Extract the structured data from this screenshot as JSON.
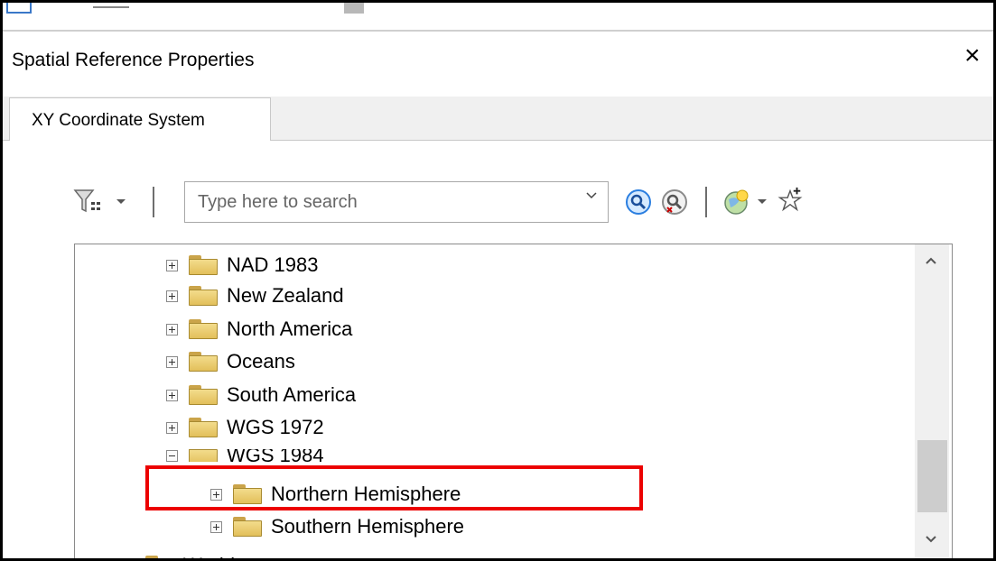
{
  "dialog": {
    "title": "Spatial Reference Properties",
    "close_glyph": "×"
  },
  "tabs": [
    {
      "label": "XY Coordinate System",
      "active": true
    }
  ],
  "toolbar": {
    "search_placeholder": "Type here to search"
  },
  "tree": {
    "items": [
      {
        "label": "NAD 1983",
        "expanded": false
      },
      {
        "label": "New Zealand",
        "expanded": false
      },
      {
        "label": "North America",
        "expanded": false
      },
      {
        "label": "Oceans",
        "expanded": false
      },
      {
        "label": "South America",
        "expanded": false
      },
      {
        "label": "WGS 1972",
        "expanded": false
      },
      {
        "label": "WGS 1984",
        "expanded": true
      },
      {
        "label": "Northern Hemisphere",
        "expanded": false,
        "highlighted": true
      },
      {
        "label": "Southern Hemisphere",
        "expanded": false
      },
      {
        "label": "World",
        "expanded": false
      }
    ]
  },
  "colors": {
    "highlight_box": "#ec0000",
    "folder": "#e8c86a",
    "search_icon": "#2a7ee0"
  },
  "icons": [
    "filter-icon",
    "search-icon",
    "clear-search-icon",
    "globe-icon",
    "add-favorite-icon",
    "close-icon",
    "folder-icon",
    "expand-icon"
  ]
}
